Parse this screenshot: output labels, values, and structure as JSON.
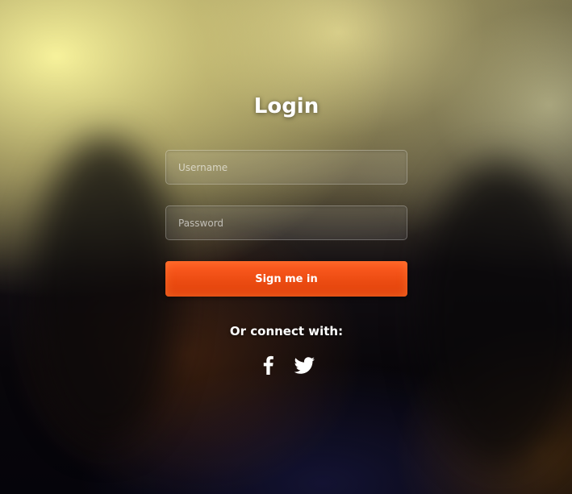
{
  "login": {
    "title": "Login",
    "username_placeholder": "Username",
    "password_placeholder": "Password",
    "submit_label": "Sign me in",
    "connect_label": "Or connect with:"
  },
  "social": {
    "icons": [
      "facebook-icon",
      "twitter-icon"
    ]
  },
  "colors": {
    "button": "#ec4c12",
    "text": "#ffffff"
  }
}
